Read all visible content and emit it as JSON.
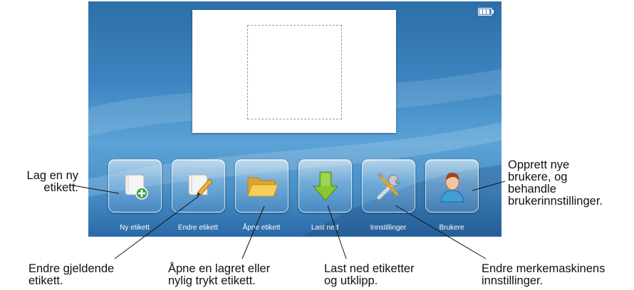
{
  "status": {
    "battery_icon": "battery-full-icon"
  },
  "buttons": [
    {
      "label": "Ny etikett",
      "icon": "new-label-icon"
    },
    {
      "label": "Endre etikett",
      "icon": "edit-label-icon"
    },
    {
      "label": "Åpne etikett",
      "icon": "open-folder-icon"
    },
    {
      "label": "Last ned",
      "icon": "download-arrow-icon"
    },
    {
      "label": "Innstillinger",
      "icon": "tools-icon"
    },
    {
      "label": "Brukere",
      "icon": "user-icon"
    }
  ],
  "callouts": {
    "new_label": [
      "Lag en ny",
      "etikett."
    ],
    "edit_label": [
      "Endre gjeldende",
      "etikett."
    ],
    "open_label": [
      "Åpne en lagret eller",
      "nylig trykt etikett."
    ],
    "download": [
      "Last ned etiketter",
      "og utklipp."
    ],
    "settings": [
      "Endre merkemaskinens",
      "innstillinger."
    ],
    "users": [
      "Opprett nye",
      "brukere, og",
      "behandle",
      "brukerinnstillinger."
    ]
  },
  "colors": {
    "screen_top": "#2d6ea8",
    "screen_mid": "#5ba3d6",
    "download_green": "#7cc22e",
    "folder_yellow": "#f2c94c"
  }
}
